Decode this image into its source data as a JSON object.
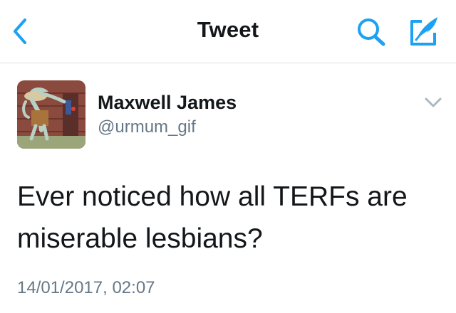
{
  "colors": {
    "accent": "#1da1f2",
    "text": "#14171a",
    "secondary": "#657786",
    "divider": "#d8dee3"
  },
  "navbar": {
    "title": "Tweet",
    "back_icon": "chevron-left-icon",
    "search_icon": "search-icon",
    "compose_icon": "compose-tweet-icon"
  },
  "tweet": {
    "author": {
      "display_name": "Maxwell James",
      "handle": "@urmum_gif",
      "avatar": "cartoon-avatar"
    },
    "more_icon": "chevron-down-icon",
    "text": "Ever noticed how all TERFs are miserable lesbians?",
    "timestamp": "14/01/2017, 02:07"
  }
}
